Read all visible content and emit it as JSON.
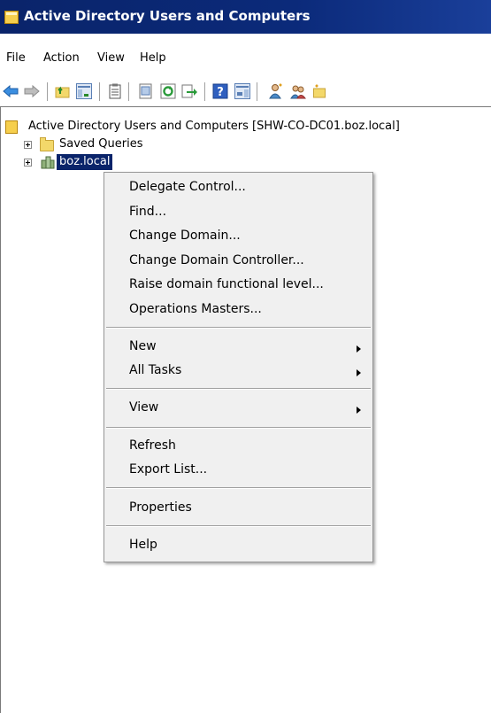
{
  "window": {
    "title": "Active Directory Users and Computers"
  },
  "menubar": {
    "items": [
      "File",
      "Action",
      "View",
      "Help"
    ]
  },
  "toolbar": {
    "buttons": [
      "back-icon",
      "forward-icon",
      "up-folder-icon",
      "show-hide-tree-icon",
      "properties-icon",
      "export-list-icon",
      "refresh-icon",
      "help-icon",
      "show-hide-action-pane-icon",
      "create-user-icon",
      "create-group-icon",
      "create-ou-icon"
    ]
  },
  "tree": {
    "root": "Active Directory Users and Computers [SHW-CO-DC01.boz.local]",
    "saved_queries": "Saved Queries",
    "domain": "boz.local"
  },
  "context_menu": {
    "items": [
      "Delegate Control...",
      "Find...",
      "Change Domain...",
      "Change Domain Controller...",
      "Raise domain functional level...",
      "Operations Masters...",
      "New",
      "All Tasks",
      "View",
      "Refresh",
      "Export List...",
      "Properties",
      "Help"
    ]
  }
}
